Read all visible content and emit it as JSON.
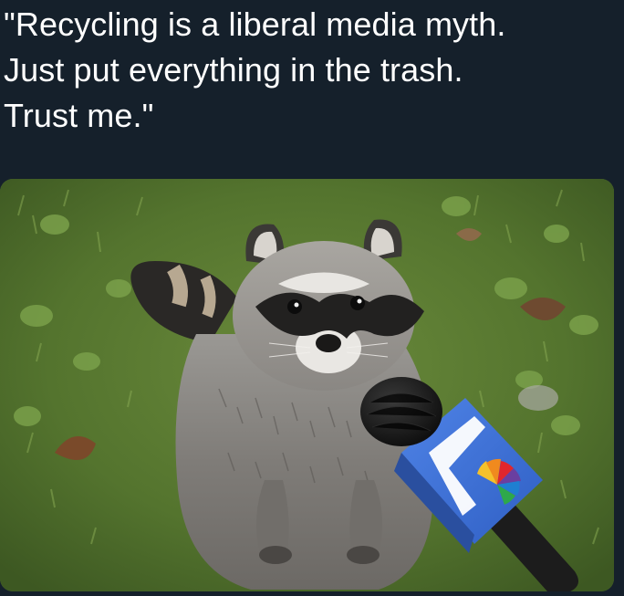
{
  "caption": {
    "lines": [
      "\"Recycling is a liberal media myth.",
      "Just put everything in the trash.",
      "Trust me.\""
    ]
  },
  "photo": {
    "subject": "raccoon-with-microphone",
    "colors": {
      "background": "#15202b",
      "grass": "#5a7a33",
      "mic_flag": "#3d6fd6",
      "fur": "#8d8a86"
    }
  }
}
